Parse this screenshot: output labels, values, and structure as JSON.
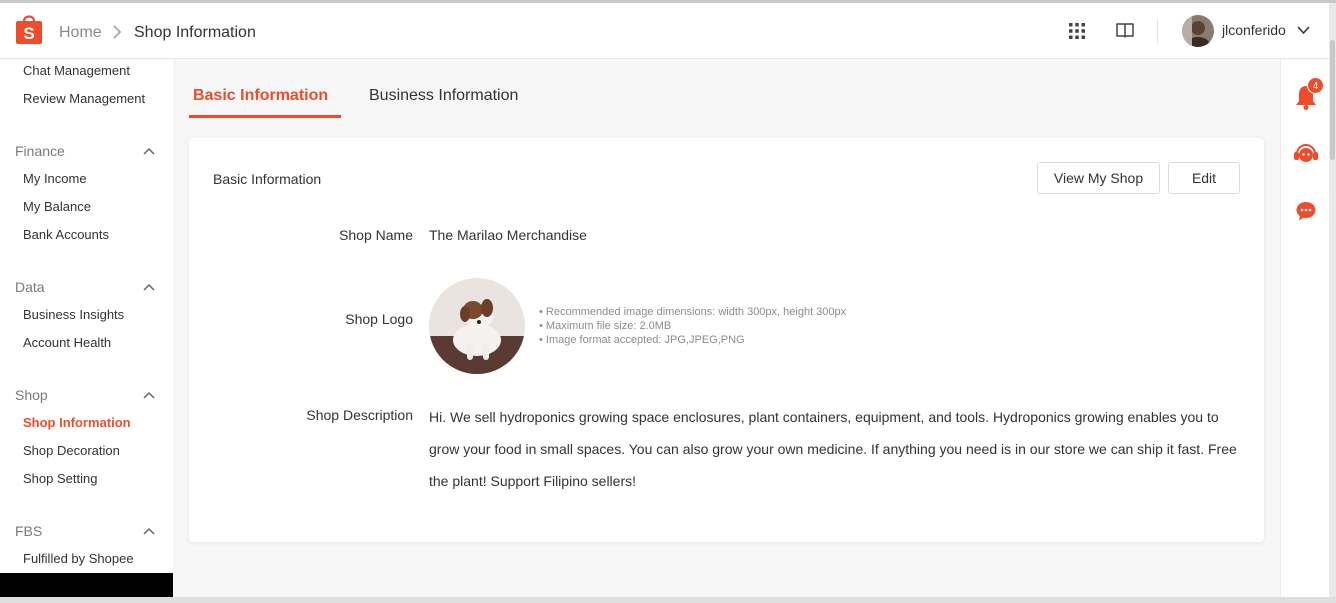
{
  "header": {
    "breadcrumb_home": "Home",
    "breadcrumb_current": "Shop Information",
    "username": "jlconferido"
  },
  "sidebar": {
    "top_items": [
      "Chat Management",
      "Review Management"
    ],
    "groups": [
      {
        "title": "Finance",
        "items": [
          "My Income",
          "My Balance",
          "Bank Accounts"
        ]
      },
      {
        "title": "Data",
        "items": [
          "Business Insights",
          "Account Health"
        ]
      },
      {
        "title": "Shop",
        "items": [
          "Shop Information",
          "Shop Decoration",
          "Shop Setting"
        ]
      },
      {
        "title": "FBS",
        "items": [
          "Fulfilled by Shopee"
        ]
      }
    ],
    "active_item": "Shop Information"
  },
  "tabs": [
    {
      "label": "Basic Information",
      "active": true
    },
    {
      "label": "Business Information",
      "active": false
    }
  ],
  "card": {
    "title": "Basic Information",
    "view_shop_button": "View My Shop",
    "edit_button": "Edit",
    "shop_name_label": "Shop Name",
    "shop_name_value": "The Marilao Merchandise",
    "shop_logo_label": "Shop Logo",
    "logo_hints": [
      "Recommended image dimensions: width 300px, height 300px",
      "Maximum file size: 2.0MB",
      "Image format accepted: JPG,JPEG,PNG"
    ],
    "description_label": "Shop Description",
    "description_value": "Hi. We sell hydroponics growing space enclosures, plant containers, equipment, and tools. Hydroponics growing enables you to grow your food in small spaces. You can also grow your own medicine. If anything you need is in our store we can ship it fast. Free the plant! Support Filipino sellers!"
  },
  "rightbar": {
    "notification_count": "4"
  },
  "colors": {
    "brand": "#ee4d2d"
  },
  "icons": [
    "shopee-logo-icon",
    "chevron-right-icon",
    "apps-grid-icon",
    "book-icon",
    "chevron-down-icon",
    "chevron-up-icon",
    "bell-icon",
    "support-agent-icon",
    "chat-bubble-icon"
  ]
}
